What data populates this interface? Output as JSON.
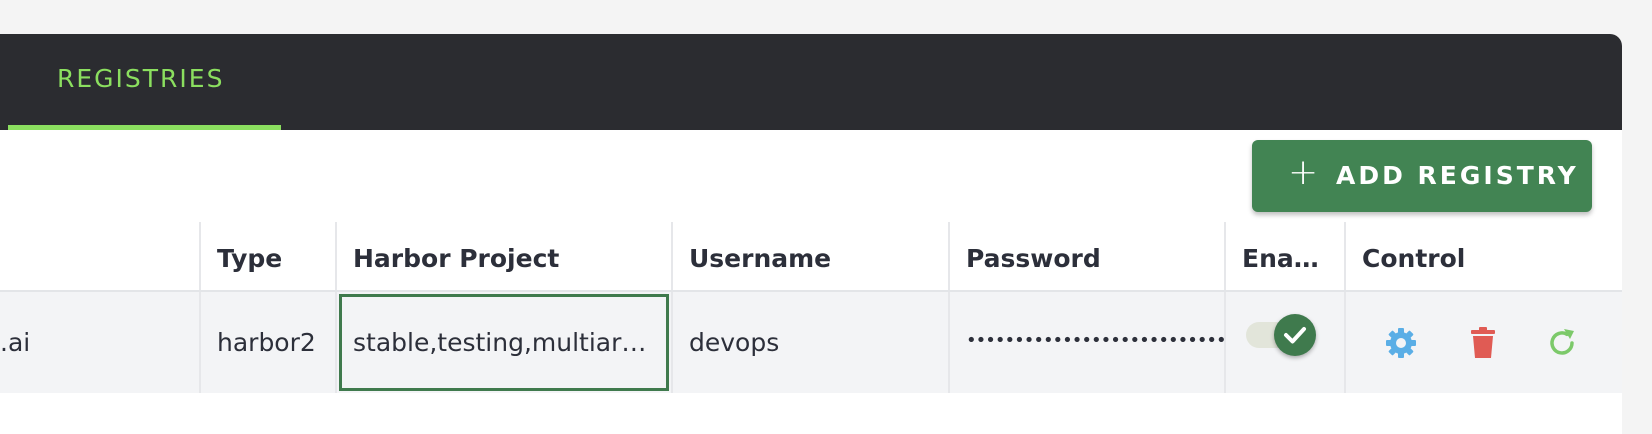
{
  "tabs": [
    {
      "label": "REGISTRIES",
      "active": true
    }
  ],
  "add_button": {
    "icon": "plus-icon",
    "label": "ADD REGISTRY"
  },
  "table": {
    "headers": {
      "type": "Type",
      "harbor_project": "Harbor Project",
      "username": "Username",
      "password": "Password",
      "enabled": "Ena…",
      "control": "Control"
    },
    "rows": [
      {
        "name": ".ai",
        "type": "harbor2",
        "harbor_project": "stable,testing,multiar…",
        "username": "devops",
        "password": "•••••••••••••••••••••••••••••",
        "enabled": true
      }
    ]
  },
  "controls": {
    "settings_icon": "gear-icon",
    "delete_icon": "trash-icon",
    "rescan_icon": "refresh-icon"
  },
  "colors": {
    "accent_green": "#8bdf5f",
    "primary": "#428453",
    "topbar": "#2b2c30",
    "gear": "#5aaee6",
    "trash": "#e05b54",
    "refresh": "#7cc96a"
  }
}
